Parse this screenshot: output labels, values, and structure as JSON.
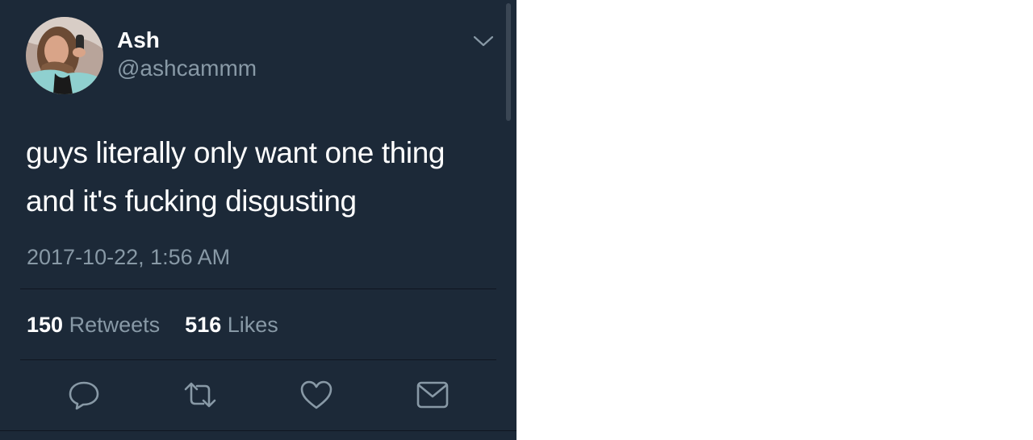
{
  "tweet": {
    "display_name": "Ash",
    "handle": "@ashcammm",
    "text_line1": "guys literally only want one thing",
    "text_line2": "and it's fucking disgusting",
    "timestamp": "2017-10-22, 1:56 AM",
    "retweets_count": "150",
    "retweets_label": "Retweets",
    "likes_count": "516",
    "likes_label": "Likes"
  },
  "icons": {
    "menu": "chevron-down-icon",
    "reply": "reply-icon",
    "retweet": "retweet-icon",
    "like": "heart-icon",
    "message": "envelope-icon"
  },
  "colors": {
    "background": "#1c2938",
    "primary_text": "#ffffff",
    "secondary_text": "#8899a6",
    "divider": "#0f1620"
  }
}
